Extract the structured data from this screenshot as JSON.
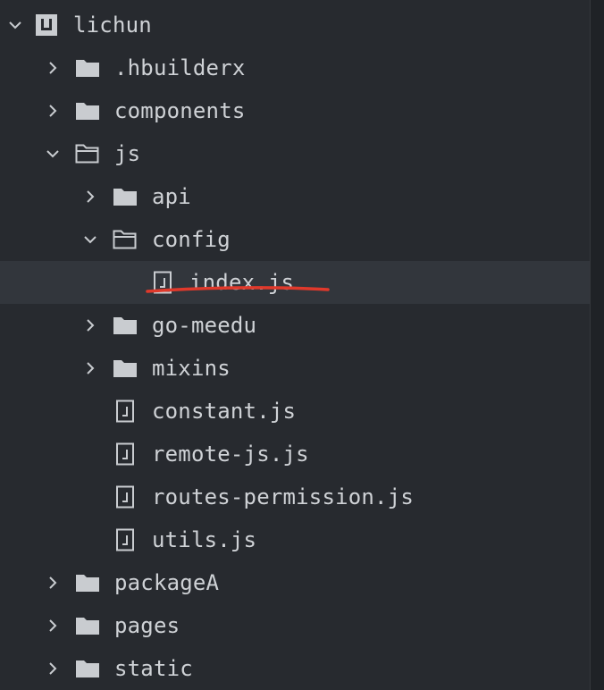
{
  "tree": {
    "root": {
      "label": "lichun",
      "icon": "project-icon",
      "expanded": true
    },
    "items": [
      {
        "label": ".hbuilderx",
        "type": "folder",
        "expanded": false
      },
      {
        "label": "components",
        "type": "folder",
        "expanded": false
      },
      {
        "label": "js",
        "type": "folder",
        "expanded": true
      },
      {
        "label": "api",
        "type": "folder",
        "expanded": false
      },
      {
        "label": "config",
        "type": "folder",
        "expanded": true
      },
      {
        "label": "index.js",
        "type": "file",
        "selected": true
      },
      {
        "label": "go-meedu",
        "type": "folder",
        "expanded": false
      },
      {
        "label": "mixins",
        "type": "folder",
        "expanded": false
      },
      {
        "label": "constant.js",
        "type": "file"
      },
      {
        "label": "remote-js.js",
        "type": "file"
      },
      {
        "label": "routes-permission.js",
        "type": "file"
      },
      {
        "label": "utils.js",
        "type": "file"
      },
      {
        "label": "packageA",
        "type": "folder",
        "expanded": false
      },
      {
        "label": "pages",
        "type": "folder",
        "expanded": false
      },
      {
        "label": "static",
        "type": "folder",
        "expanded": false
      }
    ]
  },
  "colors": {
    "background": "#272a2f",
    "selected_row": "#32363c",
    "text": "#cfd2d6",
    "annotation": "#e0392b"
  }
}
